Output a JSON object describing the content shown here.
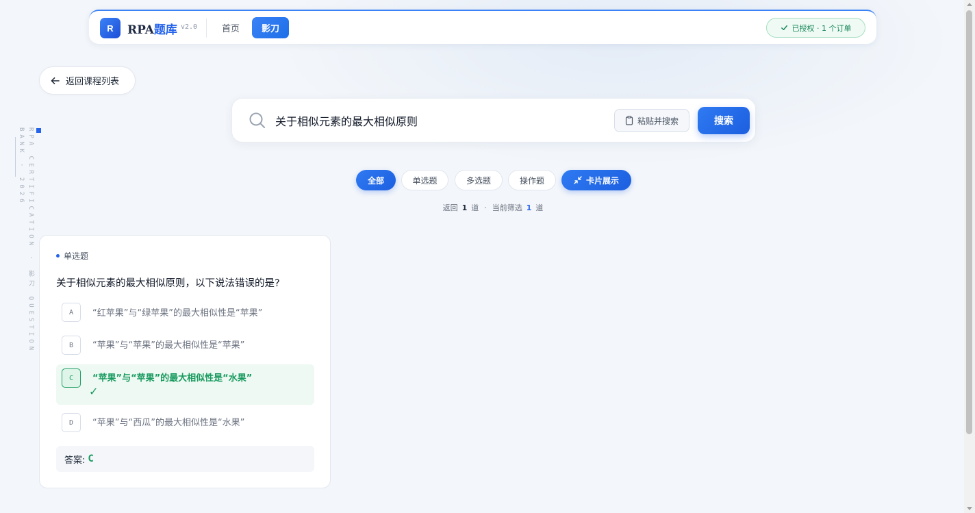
{
  "header": {
    "logo_letter": "R",
    "brand_prefix": "RPA",
    "brand_suffix": "题库",
    "version": "v2.0",
    "nav": [
      {
        "label": "首页",
        "active": false
      },
      {
        "label": "影刀",
        "active": true
      }
    ],
    "license_text": "已授权 · 1 个订单"
  },
  "back_button": {
    "label": "返回课程列表"
  },
  "side_text": "RPA CERTIFICATION · 影刀 QUESTION BANK · 2026",
  "search": {
    "value": "关于相似元素的最大相似原则",
    "paste_label": "粘贴并搜索",
    "search_label": "搜索"
  },
  "filters": [
    {
      "label": "全部",
      "active": true
    },
    {
      "label": "单选题",
      "active": false
    },
    {
      "label": "多选题",
      "active": false
    },
    {
      "label": "操作题",
      "active": false
    },
    {
      "label": "卡片展示",
      "active": true,
      "icon": "collapse-icon"
    }
  ],
  "count": {
    "prefix": "返回",
    "returned": "1",
    "unit": "道",
    "sep": "·",
    "filter_label": "当前筛选",
    "filtered": "1"
  },
  "question_card": {
    "type": "单选题",
    "question": "关于相似元素的最大相似原则，以下说法错误的是?",
    "options": [
      {
        "letter": "A",
        "text": "“红苹果”与“绿苹果”的最大相似性是“苹果”",
        "correct": false
      },
      {
        "letter": "B",
        "text": "“苹果”与“苹果”的最大相似性是“苹果”",
        "correct": false
      },
      {
        "letter": "C",
        "text": "“苹果”与“苹果”的最大相似性是“水果”",
        "correct": true,
        "mark": "✓"
      },
      {
        "letter": "D",
        "text": "“苹果”与“西瓜”的最大相似性是“水果”",
        "correct": false
      }
    ],
    "answer_label": "答案:",
    "answer_value": "C"
  },
  "colors": {
    "accent": "#2563eb",
    "correct": "#179a5e",
    "background": "#f3f6fa"
  }
}
